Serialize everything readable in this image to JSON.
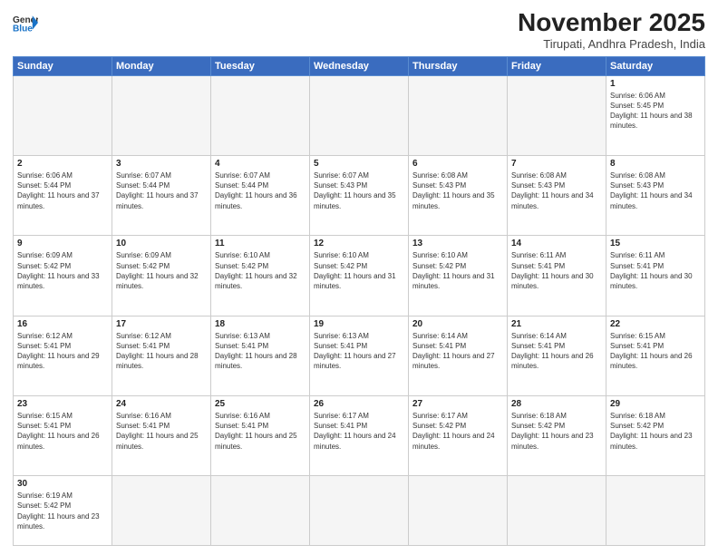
{
  "header": {
    "logo_general": "General",
    "logo_blue": "Blue",
    "month_title": "November 2025",
    "location": "Tirupati, Andhra Pradesh, India"
  },
  "weekdays": [
    "Sunday",
    "Monday",
    "Tuesday",
    "Wednesday",
    "Thursday",
    "Friday",
    "Saturday"
  ],
  "weeks": [
    [
      {
        "day": "",
        "sunrise": "",
        "sunset": "",
        "daylight": "",
        "empty": true
      },
      {
        "day": "",
        "sunrise": "",
        "sunset": "",
        "daylight": "",
        "empty": true
      },
      {
        "day": "",
        "sunrise": "",
        "sunset": "",
        "daylight": "",
        "empty": true
      },
      {
        "day": "",
        "sunrise": "",
        "sunset": "",
        "daylight": "",
        "empty": true
      },
      {
        "day": "",
        "sunrise": "",
        "sunset": "",
        "daylight": "",
        "empty": true
      },
      {
        "day": "",
        "sunrise": "",
        "sunset": "",
        "daylight": "",
        "empty": true
      },
      {
        "day": "1",
        "sunrise": "Sunrise: 6:06 AM",
        "sunset": "Sunset: 5:45 PM",
        "daylight": "Daylight: 11 hours and 38 minutes.",
        "empty": false
      }
    ],
    [
      {
        "day": "2",
        "sunrise": "Sunrise: 6:06 AM",
        "sunset": "Sunset: 5:44 PM",
        "daylight": "Daylight: 11 hours and 37 minutes.",
        "empty": false
      },
      {
        "day": "3",
        "sunrise": "Sunrise: 6:07 AM",
        "sunset": "Sunset: 5:44 PM",
        "daylight": "Daylight: 11 hours and 37 minutes.",
        "empty": false
      },
      {
        "day": "4",
        "sunrise": "Sunrise: 6:07 AM",
        "sunset": "Sunset: 5:44 PM",
        "daylight": "Daylight: 11 hours and 36 minutes.",
        "empty": false
      },
      {
        "day": "5",
        "sunrise": "Sunrise: 6:07 AM",
        "sunset": "Sunset: 5:43 PM",
        "daylight": "Daylight: 11 hours and 35 minutes.",
        "empty": false
      },
      {
        "day": "6",
        "sunrise": "Sunrise: 6:08 AM",
        "sunset": "Sunset: 5:43 PM",
        "daylight": "Daylight: 11 hours and 35 minutes.",
        "empty": false
      },
      {
        "day": "7",
        "sunrise": "Sunrise: 6:08 AM",
        "sunset": "Sunset: 5:43 PM",
        "daylight": "Daylight: 11 hours and 34 minutes.",
        "empty": false
      },
      {
        "day": "8",
        "sunrise": "Sunrise: 6:08 AM",
        "sunset": "Sunset: 5:43 PM",
        "daylight": "Daylight: 11 hours and 34 minutes.",
        "empty": false
      }
    ],
    [
      {
        "day": "9",
        "sunrise": "Sunrise: 6:09 AM",
        "sunset": "Sunset: 5:42 PM",
        "daylight": "Daylight: 11 hours and 33 minutes.",
        "empty": false
      },
      {
        "day": "10",
        "sunrise": "Sunrise: 6:09 AM",
        "sunset": "Sunset: 5:42 PM",
        "daylight": "Daylight: 11 hours and 32 minutes.",
        "empty": false
      },
      {
        "day": "11",
        "sunrise": "Sunrise: 6:10 AM",
        "sunset": "Sunset: 5:42 PM",
        "daylight": "Daylight: 11 hours and 32 minutes.",
        "empty": false
      },
      {
        "day": "12",
        "sunrise": "Sunrise: 6:10 AM",
        "sunset": "Sunset: 5:42 PM",
        "daylight": "Daylight: 11 hours and 31 minutes.",
        "empty": false
      },
      {
        "day": "13",
        "sunrise": "Sunrise: 6:10 AM",
        "sunset": "Sunset: 5:42 PM",
        "daylight": "Daylight: 11 hours and 31 minutes.",
        "empty": false
      },
      {
        "day": "14",
        "sunrise": "Sunrise: 6:11 AM",
        "sunset": "Sunset: 5:41 PM",
        "daylight": "Daylight: 11 hours and 30 minutes.",
        "empty": false
      },
      {
        "day": "15",
        "sunrise": "Sunrise: 6:11 AM",
        "sunset": "Sunset: 5:41 PM",
        "daylight": "Daylight: 11 hours and 30 minutes.",
        "empty": false
      }
    ],
    [
      {
        "day": "16",
        "sunrise": "Sunrise: 6:12 AM",
        "sunset": "Sunset: 5:41 PM",
        "daylight": "Daylight: 11 hours and 29 minutes.",
        "empty": false
      },
      {
        "day": "17",
        "sunrise": "Sunrise: 6:12 AM",
        "sunset": "Sunset: 5:41 PM",
        "daylight": "Daylight: 11 hours and 28 minutes.",
        "empty": false
      },
      {
        "day": "18",
        "sunrise": "Sunrise: 6:13 AM",
        "sunset": "Sunset: 5:41 PM",
        "daylight": "Daylight: 11 hours and 28 minutes.",
        "empty": false
      },
      {
        "day": "19",
        "sunrise": "Sunrise: 6:13 AM",
        "sunset": "Sunset: 5:41 PM",
        "daylight": "Daylight: 11 hours and 27 minutes.",
        "empty": false
      },
      {
        "day": "20",
        "sunrise": "Sunrise: 6:14 AM",
        "sunset": "Sunset: 5:41 PM",
        "daylight": "Daylight: 11 hours and 27 minutes.",
        "empty": false
      },
      {
        "day": "21",
        "sunrise": "Sunrise: 6:14 AM",
        "sunset": "Sunset: 5:41 PM",
        "daylight": "Daylight: 11 hours and 26 minutes.",
        "empty": false
      },
      {
        "day": "22",
        "sunrise": "Sunrise: 6:15 AM",
        "sunset": "Sunset: 5:41 PM",
        "daylight": "Daylight: 11 hours and 26 minutes.",
        "empty": false
      }
    ],
    [
      {
        "day": "23",
        "sunrise": "Sunrise: 6:15 AM",
        "sunset": "Sunset: 5:41 PM",
        "daylight": "Daylight: 11 hours and 26 minutes.",
        "empty": false
      },
      {
        "day": "24",
        "sunrise": "Sunrise: 6:16 AM",
        "sunset": "Sunset: 5:41 PM",
        "daylight": "Daylight: 11 hours and 25 minutes.",
        "empty": false
      },
      {
        "day": "25",
        "sunrise": "Sunrise: 6:16 AM",
        "sunset": "Sunset: 5:41 PM",
        "daylight": "Daylight: 11 hours and 25 minutes.",
        "empty": false
      },
      {
        "day": "26",
        "sunrise": "Sunrise: 6:17 AM",
        "sunset": "Sunset: 5:41 PM",
        "daylight": "Daylight: 11 hours and 24 minutes.",
        "empty": false
      },
      {
        "day": "27",
        "sunrise": "Sunrise: 6:17 AM",
        "sunset": "Sunset: 5:42 PM",
        "daylight": "Daylight: 11 hours and 24 minutes.",
        "empty": false
      },
      {
        "day": "28",
        "sunrise": "Sunrise: 6:18 AM",
        "sunset": "Sunset: 5:42 PM",
        "daylight": "Daylight: 11 hours and 23 minutes.",
        "empty": false
      },
      {
        "day": "29",
        "sunrise": "Sunrise: 6:18 AM",
        "sunset": "Sunset: 5:42 PM",
        "daylight": "Daylight: 11 hours and 23 minutes.",
        "empty": false
      }
    ],
    [
      {
        "day": "30",
        "sunrise": "Sunrise: 6:19 AM",
        "sunset": "Sunset: 5:42 PM",
        "daylight": "Daylight: 11 hours and 23 minutes.",
        "empty": false
      },
      {
        "day": "",
        "empty": true
      },
      {
        "day": "",
        "empty": true
      },
      {
        "day": "",
        "empty": true
      },
      {
        "day": "",
        "empty": true
      },
      {
        "day": "",
        "empty": true
      },
      {
        "day": "",
        "empty": true
      }
    ]
  ]
}
